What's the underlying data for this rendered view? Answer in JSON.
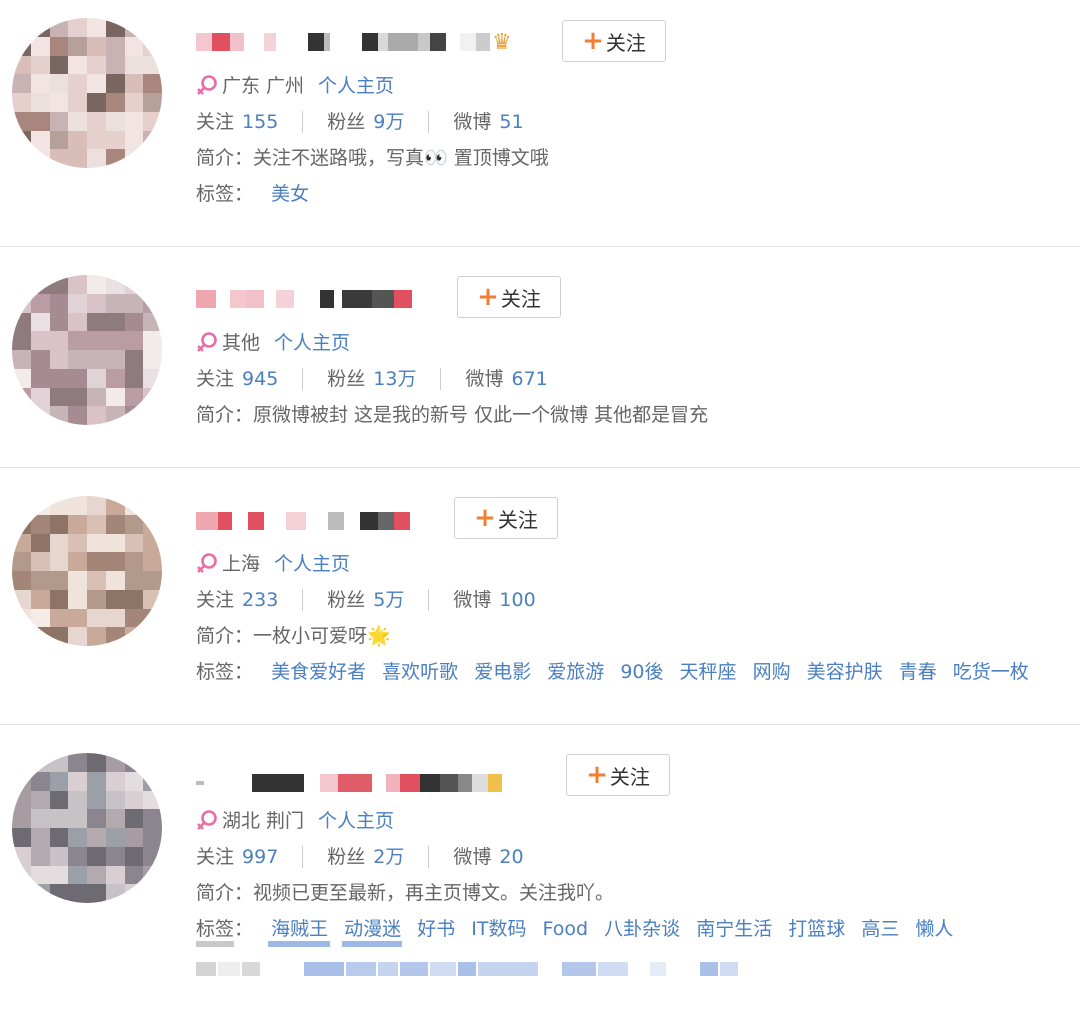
{
  "follow_label": "关注",
  "colors": {
    "accent_orange": "#f07e33",
    "link_blue": "#4a7fc1",
    "female_pink": "#e86ea6"
  },
  "icons": {
    "gender": "female-icon",
    "follow_plus": "plus-icon",
    "name_badge": "crown-icon"
  },
  "users": [
    {
      "location": "广东 广州",
      "homepage": "个人主页",
      "stats": {
        "following_label": "关注",
        "following": "155",
        "fans_label": "粉丝",
        "fans": "9万",
        "posts_label": "微博",
        "posts": "51"
      },
      "bio": "简介：关注不迷路哦，写真👀 置顶博文哦",
      "tags_label": "标签：",
      "tags": [
        "美女"
      ]
    },
    {
      "location": "其他",
      "homepage": "个人主页",
      "stats": {
        "following_label": "关注",
        "following": "945",
        "fans_label": "粉丝",
        "fans": "13万",
        "posts_label": "微博",
        "posts": "671"
      },
      "bio": "简介：原微博被封 这是我的新号 仅此一个微博 其他都是冒充",
      "tags_label": "",
      "tags": []
    },
    {
      "location": "上海",
      "homepage": "个人主页",
      "stats": {
        "following_label": "关注",
        "following": "233",
        "fans_label": "粉丝",
        "fans": "5万",
        "posts_label": "微博",
        "posts": "100"
      },
      "bio": "简介：一枚小可爱呀🌟",
      "tags_label": "标签：",
      "tags": [
        "美食爱好者",
        "喜欢听歌",
        "爱电影",
        "爱旅游",
        "90後",
        "天秤座",
        "网购",
        "美容护肤",
        "青春",
        "吃货一枚"
      ]
    },
    {
      "location": "湖北 荆门",
      "homepage": "个人主页",
      "stats": {
        "following_label": "关注",
        "following": "997",
        "fans_label": "粉丝",
        "fans": "2万",
        "posts_label": "微博",
        "posts": "20"
      },
      "bio": "简介：视频已更至最新，再主页博文。关注我吖。",
      "tags_label": "标签：",
      "tags": [
        "海贼王",
        "动漫迷",
        "好书",
        "IT数码",
        "Food",
        "八卦杂谈",
        "南宁生活",
        "打篮球",
        "高三",
        "懒人"
      ]
    }
  ]
}
